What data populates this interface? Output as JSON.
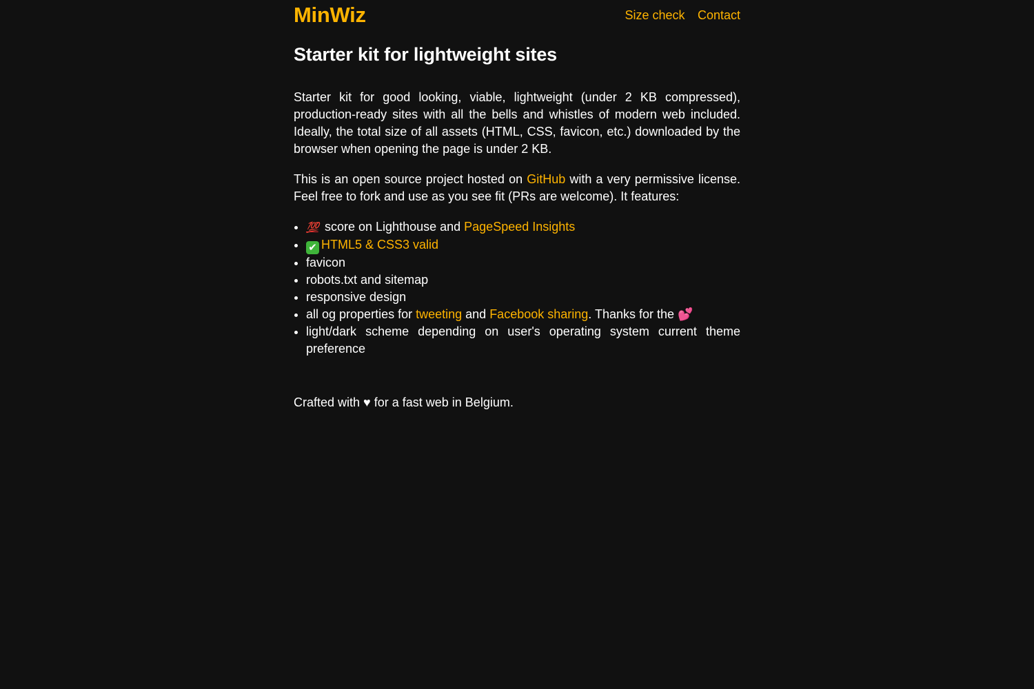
{
  "header": {
    "logo": "MinWiz",
    "nav": [
      "Size check",
      "Contact"
    ]
  },
  "main": {
    "title": "Starter kit for lightweight sites",
    "intro": "Starter kit for good looking, viable, lightweight (under 2 KB compressed), production-ready sites with all the bells and whistles of modern web included. Ideally, the total size of all assets (HTML, CSS, favicon, etc.) downloaded by the browser when opening the page is under 2 KB.",
    "open_source": {
      "before": "This is an open source project hosted on ",
      "link": "GitHub",
      "after": " with a very permissive license. Feel free to fork and use as you see fit (PRs are welcome). It features:"
    },
    "features": {
      "f1_emoji": "💯",
      "f1_text": " score on Lighthouse and ",
      "f1_link": "PageSpeed Insights",
      "f2_emoji": "✔",
      "f2_link": "HTML5 & CSS3 valid",
      "f3": "favicon",
      "f4": "robots.txt and sitemap",
      "f5": "responsive design",
      "f6_text1": "all og properties for ",
      "f6_link1": "tweeting",
      "f6_text2": " and ",
      "f6_link2": "Facebook sharing",
      "f6_text3": ". Thanks for the ",
      "f6_emoji": "💕",
      "f7": "light/dark scheme depending on user's operating system current theme preference"
    }
  },
  "footer": {
    "before": "Crafted with ",
    "heart": "♥",
    "after": " for a fast web in Belgium."
  },
  "colors": {
    "background": "#111111",
    "accent": "#ffb400",
    "text": "#ffffff"
  }
}
